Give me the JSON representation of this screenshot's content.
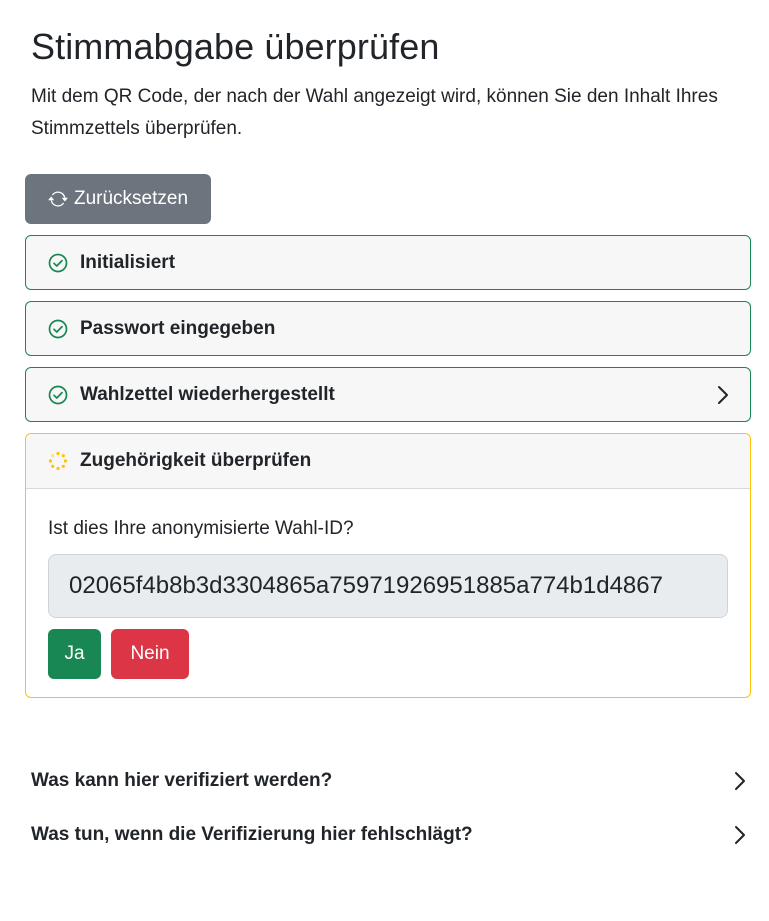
{
  "page": {
    "title": "Stimmabgabe überprüfen",
    "intro": "Mit dem QR Code, der nach der Wahl angezeigt wird, können Sie den Inhalt Ihres Stimmzettels überprüfen."
  },
  "toolbar": {
    "reset_label": "Zurücksetzen",
    "reset_icon": "refresh-icon"
  },
  "steps": [
    {
      "label": "Initialisiert",
      "status": "done",
      "icon": "check-circle-icon"
    },
    {
      "label": "Passwort eingegeben",
      "status": "done",
      "icon": "check-circle-icon"
    },
    {
      "label": "Wahlzettel wiederhergestellt",
      "status": "done",
      "icon": "check-circle-icon",
      "expandable": true
    }
  ],
  "active_step": {
    "label": "Zugehörigkeit überprüfen",
    "status": "in-progress",
    "icon": "spinner-icon",
    "question": "Ist dies Ihre anonymisierte Wahl-ID?",
    "election_id": "02065f4b8b3d3304865a75971926951885a774b1d4867",
    "yes_label": "Ja",
    "no_label": "Nein"
  },
  "faq": [
    {
      "label": "Was kann hier verifiziert werden?"
    },
    {
      "label": "Was tun, wenn die Verifizierung hier fehlschlägt?"
    }
  ],
  "colors": {
    "success": "#198754",
    "warning": "#ffc107",
    "danger": "#dc3545",
    "secondary": "#6c757d"
  }
}
